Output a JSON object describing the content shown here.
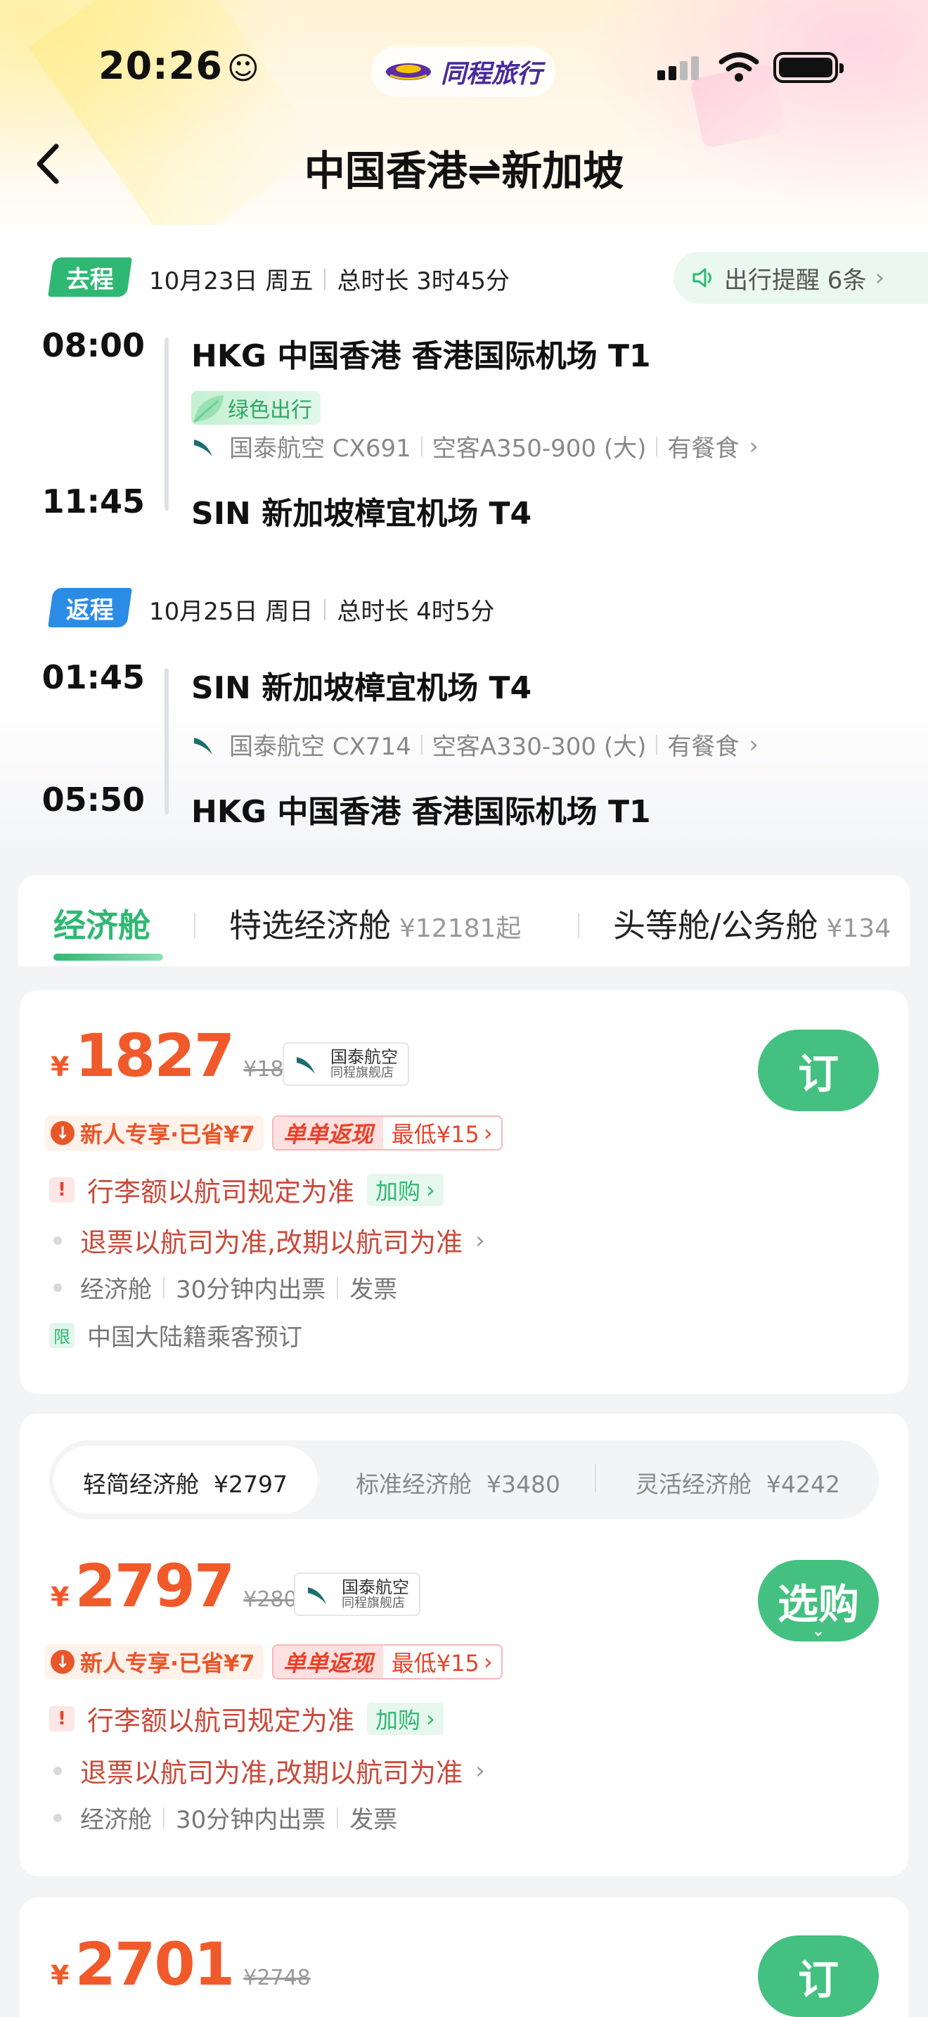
{
  "status_bar": {
    "time": "20:26",
    "emoji": "☺",
    "brand": "同程旅行"
  },
  "header": {
    "title": "中国香港⇌新加坡"
  },
  "itinerary": {
    "reminder": "出行提醒 6条",
    "outbound": {
      "tag": "去程",
      "date": "10月23日 周五",
      "duration": "总时长 3时45分",
      "dep_time": "08:00",
      "dep_airport": "HKG 中国香港 香港国际机场 T1",
      "green_badge": "绿色出行",
      "airline": "国泰航空 CX691",
      "aircraft": "空客A350-900 (大)",
      "meal": "有餐食",
      "arr_time": "11:45",
      "arr_airport": "SIN 新加坡樟宜机场 T4"
    },
    "return": {
      "tag": "返程",
      "date": "10月25日 周日",
      "duration": "总时长 4时5分",
      "dep_time": "01:45",
      "dep_airport": "SIN 新加坡樟宜机场 T4",
      "airline": "国泰航空 CX714",
      "aircraft": "空客A330-300 (大)",
      "meal": "有餐食",
      "arr_time": "05:50",
      "arr_airport": "HKG 中国香港 香港国际机场 T1"
    }
  },
  "cabin_tabs": [
    {
      "label": "经济舱",
      "price": ""
    },
    {
      "label": "特选经济舱",
      "price": "¥12181起"
    },
    {
      "label": "头等舱/公务舱",
      "price": "¥134"
    }
  ],
  "offers": [
    {
      "currency": "¥",
      "price": "1827",
      "old_price": "¥1834",
      "airline_name": "国泰航空",
      "store": "同程旗舰店",
      "button": "订",
      "promo_new": "新人专享·已省¥7",
      "promo_cash_label": "单单返现",
      "promo_cash_value": "最低¥15",
      "baggage": "行李额以航司规定为准",
      "addon": "加购",
      "refund_a": "退票以航司为准",
      "refund_b": "改期以航司为准",
      "cabin": "经济舱",
      "ticketing": "30分钟内出票",
      "invoice": "发票",
      "limit_tag": "限",
      "restriction": "中国大陆籍乘客预订"
    },
    {
      "sub_tabs": [
        {
          "label": "轻简经济舱",
          "price": "¥2797"
        },
        {
          "label": "标准经济舱",
          "price": "¥3480"
        },
        {
          "label": "灵活经济舱",
          "price": "¥4242"
        }
      ],
      "currency": "¥",
      "price": "2797",
      "old_price": "¥2804",
      "airline_name": "国泰航空",
      "store": "同程旗舰店",
      "button": "选购",
      "promo_new": "新人专享·已省¥7",
      "promo_cash_label": "单单返现",
      "promo_cash_value": "最低¥15",
      "baggage": "行李额以航司规定为准",
      "addon": "加购",
      "refund_a": "退票以航司为准",
      "refund_b": "改期以航司为准",
      "cabin": "经济舱",
      "ticketing": "30分钟内出票",
      "invoice": "发票"
    },
    {
      "currency": "¥",
      "price": "2701",
      "old_price": "¥2748",
      "button": "订"
    }
  ],
  "colors": {
    "green": "#2fb873",
    "price_orange": "#f05a2a",
    "blue_tag": "#2b8ce6"
  }
}
